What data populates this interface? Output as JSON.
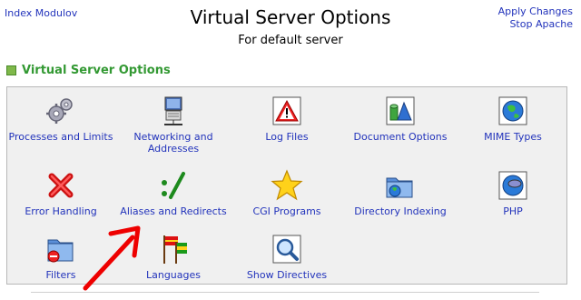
{
  "nav": {
    "index_link": "Index Modulov",
    "apply_changes": "Apply Changes",
    "stop_apache": "Stop Apache"
  },
  "page": {
    "title": "Virtual Server Options",
    "subtitle": "For default server"
  },
  "section": {
    "title": "Virtual Server Options"
  },
  "options": [
    {
      "label": "Processes and Limits",
      "icon": "gears-icon"
    },
    {
      "label": "Networking and Addresses",
      "icon": "network-computer-icon"
    },
    {
      "label": "Log Files",
      "icon": "warning-icon"
    },
    {
      "label": "Document Options",
      "icon": "document-options-icon"
    },
    {
      "label": "MIME Types",
      "icon": "mime-globe-icon"
    },
    {
      "label": "Error Handling",
      "icon": "red-x-icon"
    },
    {
      "label": "Aliases and Redirects",
      "icon": "alias-slash-icon"
    },
    {
      "label": "CGI Programs",
      "icon": "star-icon"
    },
    {
      "label": "Directory Indexing",
      "icon": "folder-globe-icon"
    },
    {
      "label": "PHP",
      "icon": "php-globe-icon"
    },
    {
      "label": "Filters",
      "icon": "filter-folder-icon"
    },
    {
      "label": "Languages",
      "icon": "flags-icon"
    },
    {
      "label": "Show Directives",
      "icon": "magnifier-icon"
    }
  ],
  "colors": {
    "link": "#2233bb",
    "section_green": "#339933",
    "panel_bg": "#f0f0f0",
    "annotation_red": "#ee0000"
  }
}
